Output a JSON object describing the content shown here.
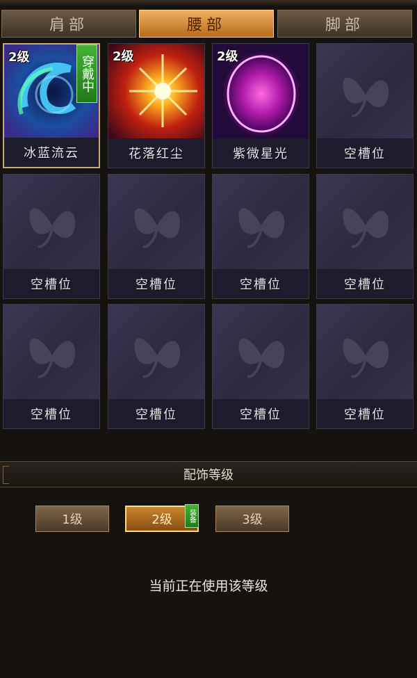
{
  "tabs": [
    "肩部",
    "腰部",
    "脚部"
  ],
  "slots": [
    {
      "name": "冰蓝流云",
      "level": "2级",
      "wearing": "穿戴中"
    },
    {
      "name": "花落红尘",
      "level": "2级"
    },
    {
      "name": "紫微星光",
      "level": "2级"
    },
    {
      "name": "空槽位"
    },
    {
      "name": "空槽位"
    },
    {
      "name": "空槽位"
    },
    {
      "name": "空槽位"
    },
    {
      "name": "空槽位"
    },
    {
      "name": "空槽位"
    },
    {
      "name": "空槽位"
    },
    {
      "name": "空槽位"
    },
    {
      "name": "空槽位"
    }
  ],
  "section_title": "配饰等级",
  "levels": [
    "1级",
    "2级",
    "3级"
  ],
  "equip_tag": "装备",
  "status_text": "当前正在使用该等级",
  "colors": {
    "active_tab": "#d8903c",
    "equip_green": "#2f9a24",
    "slot_bg": "#33304a"
  }
}
